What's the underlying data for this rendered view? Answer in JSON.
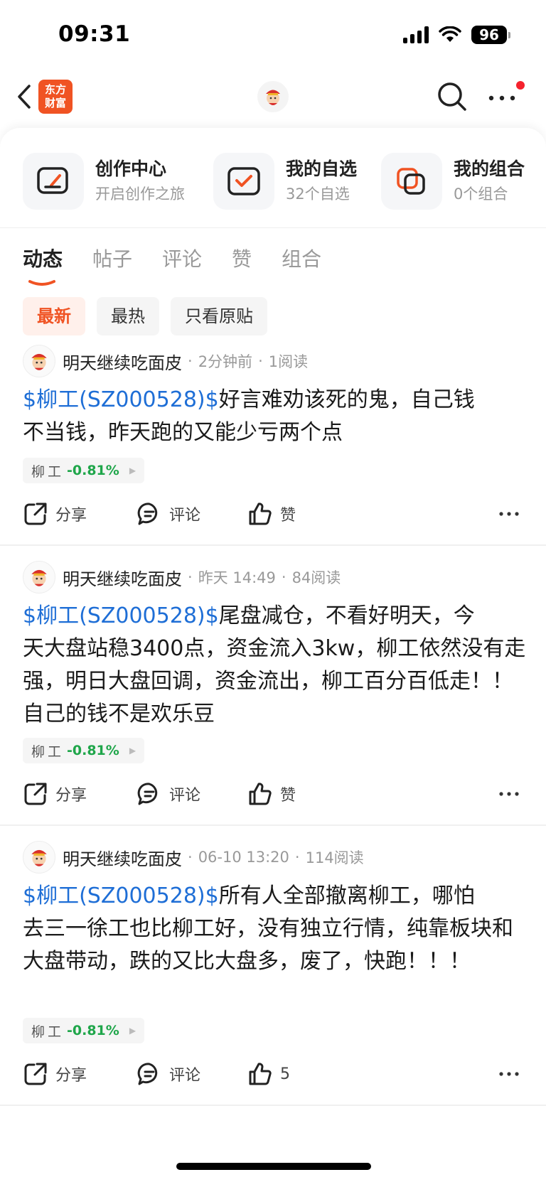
{
  "status_bar": {
    "time": "09:31",
    "battery": "96"
  },
  "nav": {
    "logo_line1": "东方",
    "logo_line2": "财富"
  },
  "quick_entries": [
    {
      "title": "创作中心",
      "subtitle": "开启创作之旅",
      "icon": "edit-icon"
    },
    {
      "title": "我的自选",
      "subtitle": "32个自选",
      "icon": "checklist-icon"
    },
    {
      "title": "我的组合",
      "subtitle": "0个组合",
      "icon": "portfolio-icon"
    }
  ],
  "tabs": [
    "动态",
    "帖子",
    "评论",
    "赞",
    "组合"
  ],
  "filters": [
    "最新",
    "最热",
    "只看原贴"
  ],
  "posts": [
    {
      "author": "明天继续吃面皮",
      "time": "2分钟前",
      "reads": "1阅读",
      "stock_link": "$柳工(SZ000528)$",
      "body_line1": "好言难劝该死的鬼，自己钱",
      "body_rest": "不当钱，昨天跑的又能少亏两个点",
      "tag_name": "柳工",
      "tag_change": "-0.81%",
      "share": "分享",
      "comment": "评论",
      "like": "赞"
    },
    {
      "author": "明天继续吃面皮",
      "time": "昨天 14:49",
      "reads": "84阅读",
      "stock_link": "$柳工(SZ000528)$",
      "body_line1": "尾盘减仓，不看好明天，今",
      "body_rest": "天大盘站稳3400点，资金流入3kw，柳工依然没有走强，明日大盘回调，资金流出，柳工百分百低走！！自己的钱不是欢乐豆",
      "tag_name": "柳工",
      "tag_change": "-0.81%",
      "share": "分享",
      "comment": "评论",
      "like": "赞"
    },
    {
      "author": "明天继续吃面皮",
      "time": "06-10 13:20",
      "reads": "114阅读",
      "stock_link": "$柳工(SZ000528)$",
      "body_line1": "所有人全部撤离柳工，哪怕",
      "body_rest": "去三一徐工也比柳工好，没有独立行情，纯靠板块和大盘带动，跌的又比大盘多，废了，快跑！！！",
      "tag_name": "柳工",
      "tag_change": "-0.81%",
      "share": "分享",
      "comment": "评论",
      "like": "5"
    }
  ],
  "colors": {
    "accent": "#f05323",
    "link": "#1e6ed6",
    "down": "#1fa64a"
  }
}
